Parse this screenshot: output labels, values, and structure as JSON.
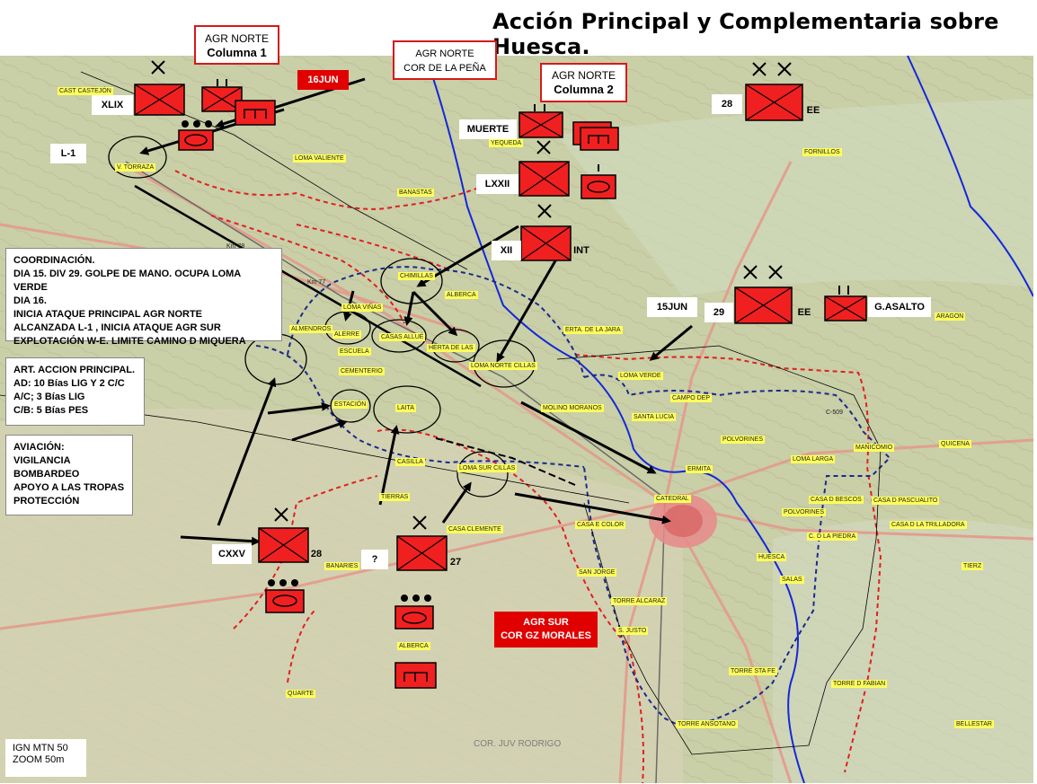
{
  "title": "Acción Principal y Complementaria sobre Huesca.",
  "colors": {
    "unit_fill": "#f02020",
    "front_red": "#e02020",
    "front_blue": "#1a2a8a",
    "river": "#1428d8",
    "map_bg": "#c9cfa7",
    "label_yellow": "#ffff5a"
  },
  "boxes": {
    "agr_norte_col1": {
      "line1": "AGR NORTE",
      "line2": "Columna 1"
    },
    "agr_norte_pena": {
      "line1": "AGR NORTE",
      "line2": "COR DE LA PEÑA"
    },
    "agr_norte_col2": {
      "line1": "AGR NORTE",
      "line2": "Columna 2"
    },
    "agr_sur": {
      "line1": "AGR SUR",
      "line2": "COR GZ MORALES"
    },
    "date_16jun": "16JUN",
    "date_15jun": "15JUN"
  },
  "unit_labels": {
    "xlix": "XLIX",
    "l1": "L-1",
    "muerte": "MUERTE",
    "lxxii": "LXXII",
    "xii": "XII",
    "int": "INT",
    "u28_top": "28",
    "ee_top": "EE",
    "u29": "29",
    "ee_mid": "EE",
    "g_asalto": "G.ASALTO",
    "cxxv": "CXXV",
    "u28_bottom": "28",
    "question": "?",
    "u27": "27"
  },
  "coordination": {
    "header": "COORDINACIÓN.",
    "lines": [
      "DIA 15. DIV 29. GOLPE DE MANO. OCUPA LOMA VERDE",
      "DIA 16.",
      "INICIA ATAQUE PRINCIPAL AGR NORTE",
      "ALCANZADA L-1 , INICIA ATAQUE AGR SUR",
      "EXPLOTACIÓN W-E. LIMITE CAMINO D MIQUERA"
    ]
  },
  "artillery": {
    "header": "ART. ACCION PRINCIPAL.",
    "lines": [
      "AD: 10 Bías LIG Y 2 C/C",
      "A/C; 3 Bías LIG",
      "C/B: 5 Bías PES"
    ]
  },
  "aviation": {
    "header": "AVIACIÓN:",
    "lines": [
      "VIGILANCIA",
      "BOMBARDEO",
      "APOYO A LAS TROPAS",
      "PROTECCIÓN"
    ]
  },
  "source_note": {
    "line1": "IGN MTN 50",
    "line2": "ZOOM 50m"
  },
  "author_watermark": "COR. JUV RODRIGO",
  "map_places": [
    "CAST CASTEJÓN",
    "V. TORRAZA",
    "LOMA VALIENTE",
    "BANASTAS",
    "YEQUEDA",
    "FORNILLOS",
    "CHIMILLAS",
    "ALBERCA",
    "LOMA VIÑAS",
    "ALMENDROS",
    "ALERRE",
    "CASAS ALLUÉ",
    "ESCUELA",
    "HERTA DE LAS",
    "LOMA NORTE CILLAS",
    "CEMENTERIO",
    "ESTACIÓN",
    "LAITA",
    "MOLINO MORANOS",
    "ERTA. DE LA JARA",
    "ARAGON",
    "LOMA VERDE",
    "CAMPO DEP",
    "SANTA LUCIA",
    "POLVORINES",
    "ERMITA",
    "LOMA LARGA",
    "MANICOMIO",
    "QUICENA",
    "CASILLA",
    "LOMA SUR CILLAS",
    "CATEDRAL",
    "TIERRAS",
    "CASA CLEMENTE",
    "CASA E COLOR",
    "SAN JORGE",
    "TORRE ALCARAZ",
    "CASA D BESCOS",
    "CASA D PASCUALITO",
    "POLVORINES",
    "CASA D LA TRILLADORA",
    "C. D LA PIEDRA",
    "HUESCA",
    "SALAS",
    "TIERZ",
    "BANARIES",
    "ALBERCA",
    "S. JUSTO",
    "TORRE STA FE",
    "TORRE D FABIAN",
    "TORRE ANSOTANO",
    "BELLESTAR",
    "QUARTE",
    "Km 78",
    "Km 77",
    "C-509"
  ]
}
